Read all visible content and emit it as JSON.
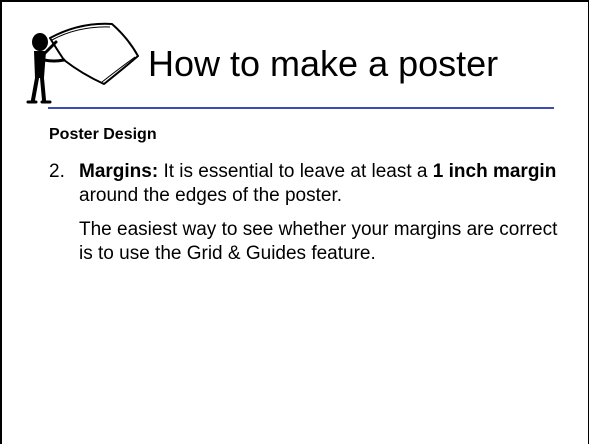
{
  "slide": {
    "title": "How to make a poster",
    "section_heading": "Poster Design",
    "item": {
      "number": "2.",
      "bold_label": "Margins:",
      "text_before_bold": " It is essential to leave at least a ",
      "bold_phrase": "1 inch margin",
      "text_after_bold": " around the edges of the poster."
    },
    "paragraph": "The easiest way to see whether your margins are correct is to use the Grid & Guides feature."
  },
  "colors": {
    "title_rule": "#3b4cb0",
    "text": "#000000",
    "background": "#ffffff"
  },
  "icons": {
    "clipart": "figure-holding-blank-sign-icon"
  }
}
